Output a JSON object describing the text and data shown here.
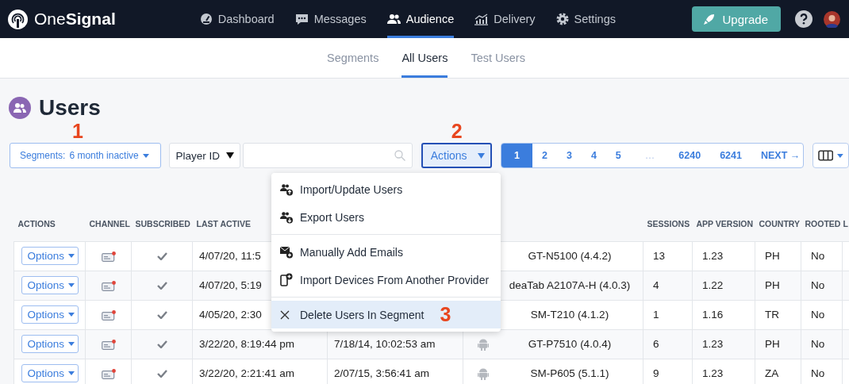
{
  "header": {
    "logo": "One**Signal**",
    "nav": [
      {
        "label": "Dashboard",
        "selected": false
      },
      {
        "label": "Messages",
        "selected": false
      },
      {
        "label": "Audience",
        "selected": true
      },
      {
        "label": "Delivery",
        "selected": false
      },
      {
        "label": "Settings",
        "selected": false
      }
    ],
    "upgrade_button": "Upgrade"
  },
  "subtabs": [
    {
      "label": "Segments",
      "selected": false
    },
    {
      "label": "All Users",
      "selected": true
    },
    {
      "label": "Test Users",
      "selected": false
    }
  ],
  "page_title": "Users",
  "toolbar": {
    "segments_button": {
      "label": "Segments:",
      "value": "6 month inactive",
      "annotation": "1"
    },
    "filter_select": "Player ID",
    "actions_button": {
      "label": "Actions",
      "open": true,
      "annotation": "2"
    },
    "pagination": [
      {
        "label": "1",
        "kind": "page",
        "selected": true
      },
      {
        "label": "2",
        "kind": "page",
        "selected": false
      },
      {
        "label": "3",
        "kind": "page",
        "selected": false
      },
      {
        "label": "4",
        "kind": "page",
        "selected": false
      },
      {
        "label": "5",
        "kind": "page",
        "selected": false
      },
      {
        "label": "…",
        "kind": "gap",
        "selected": false
      },
      {
        "label": "6240",
        "kind": "page",
        "selected": false
      },
      {
        "label": "6241",
        "kind": "page",
        "selected": false
      },
      {
        "label": "NEXT →",
        "kind": "next",
        "selected": false
      }
    ]
  },
  "actions_menu": {
    "groups": [
      [
        {
          "label": "Import/Update Users",
          "selected": false
        },
        {
          "label": "Export Users",
          "selected": false
        }
      ],
      [
        {
          "label": "Manually Add Emails",
          "selected": false
        },
        {
          "label": "Import Devices From Another Provider",
          "selected": false
        }
      ],
      [
        {
          "label": "Delete Users In Segment",
          "selected": true,
          "annotation": "3"
        }
      ]
    ]
  },
  "table": {
    "columns": [
      {
        "label": "ACTIONS"
      },
      {
        "label": "CHANNEL"
      },
      {
        "label": "SUBSCRIBED"
      },
      {
        "label": "LAST ACTIVE"
      },
      {},
      {},
      {
        "label": "SESSIONS"
      },
      {
        "label": "APP VERSION"
      },
      {
        "label": "COUNTRY"
      },
      {
        "label": "ROOTED"
      },
      {
        "label": "L"
      }
    ],
    "rows": [
      {
        "options": "Options",
        "subscribed": true,
        "last_active": "4/07/20, 11:5",
        "column_6": "GT-N5100 (4.4.2)",
        "sessions": "13",
        "app_version": "1.23",
        "country": "PH",
        "rooted": "No"
      },
      {
        "options": "Options",
        "subscribed": true,
        "last_active": "4/07/20, 5:19",
        "column_6": "deaTab A2107A-H (4.0.3)",
        "sessions": "4",
        "app_version": "1.22",
        "country": "PH",
        "rooted": "No"
      },
      {
        "options": "Options",
        "subscribed": true,
        "last_active": "4/05/20, 2:30",
        "column_6": "SM-T210 (4.1.2)",
        "sessions": "1",
        "app_version": "1.16",
        "country": "TR",
        "rooted": "No"
      },
      {
        "options": "Options",
        "subscribed": true,
        "last_active": "3/22/20, 8:19:44 pm",
        "column_5": "7/18/14, 10:02:53 am",
        "device_icon": true,
        "column_6": "GT-P7510 (4.0.4)",
        "sessions": "6",
        "app_version": "1.23",
        "country": "PH",
        "rooted": "No"
      },
      {
        "options": "Options",
        "subscribed": true,
        "last_active": "3/22/20, 2:21:41 am",
        "column_5": "2/07/15, 3:56:41 am",
        "device_icon": true,
        "column_6": "SM-P605 (5.1.1)",
        "sessions": "9",
        "app_version": "1.23",
        "country": "ZA",
        "rooted": "No"
      }
    ]
  }
}
